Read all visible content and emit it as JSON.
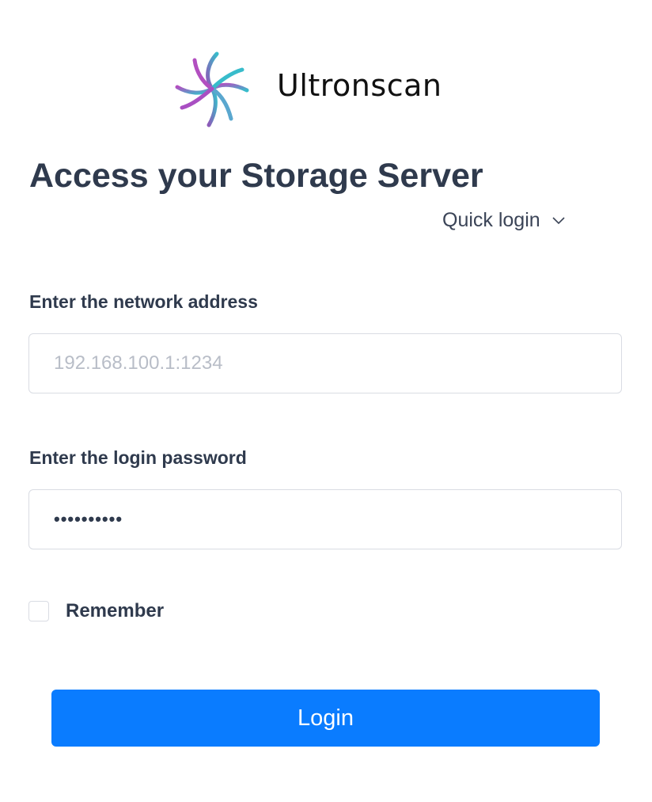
{
  "brand": {
    "name": "Ultronscan",
    "logo_icon": "ultronscan-logo-icon"
  },
  "page_title": "Access your Storage Server",
  "quick_login": {
    "label": "Quick login",
    "icon": "chevron-down-icon"
  },
  "form": {
    "address": {
      "label": "Enter the network address",
      "placeholder": "192.168.100.1:1234",
      "value": ""
    },
    "password": {
      "label": "Enter the login password",
      "masked_value": "••••••••••"
    },
    "remember": {
      "label": "Remember",
      "checked": false
    },
    "submit_label": "Login"
  },
  "colors": {
    "primary": "#0a7cff",
    "text": "#2f3a4d",
    "border": "#d9dce3",
    "placeholder": "#b8bdc7",
    "logo_purple": "#9b4fbf",
    "logo_teal": "#3fb8c9"
  }
}
